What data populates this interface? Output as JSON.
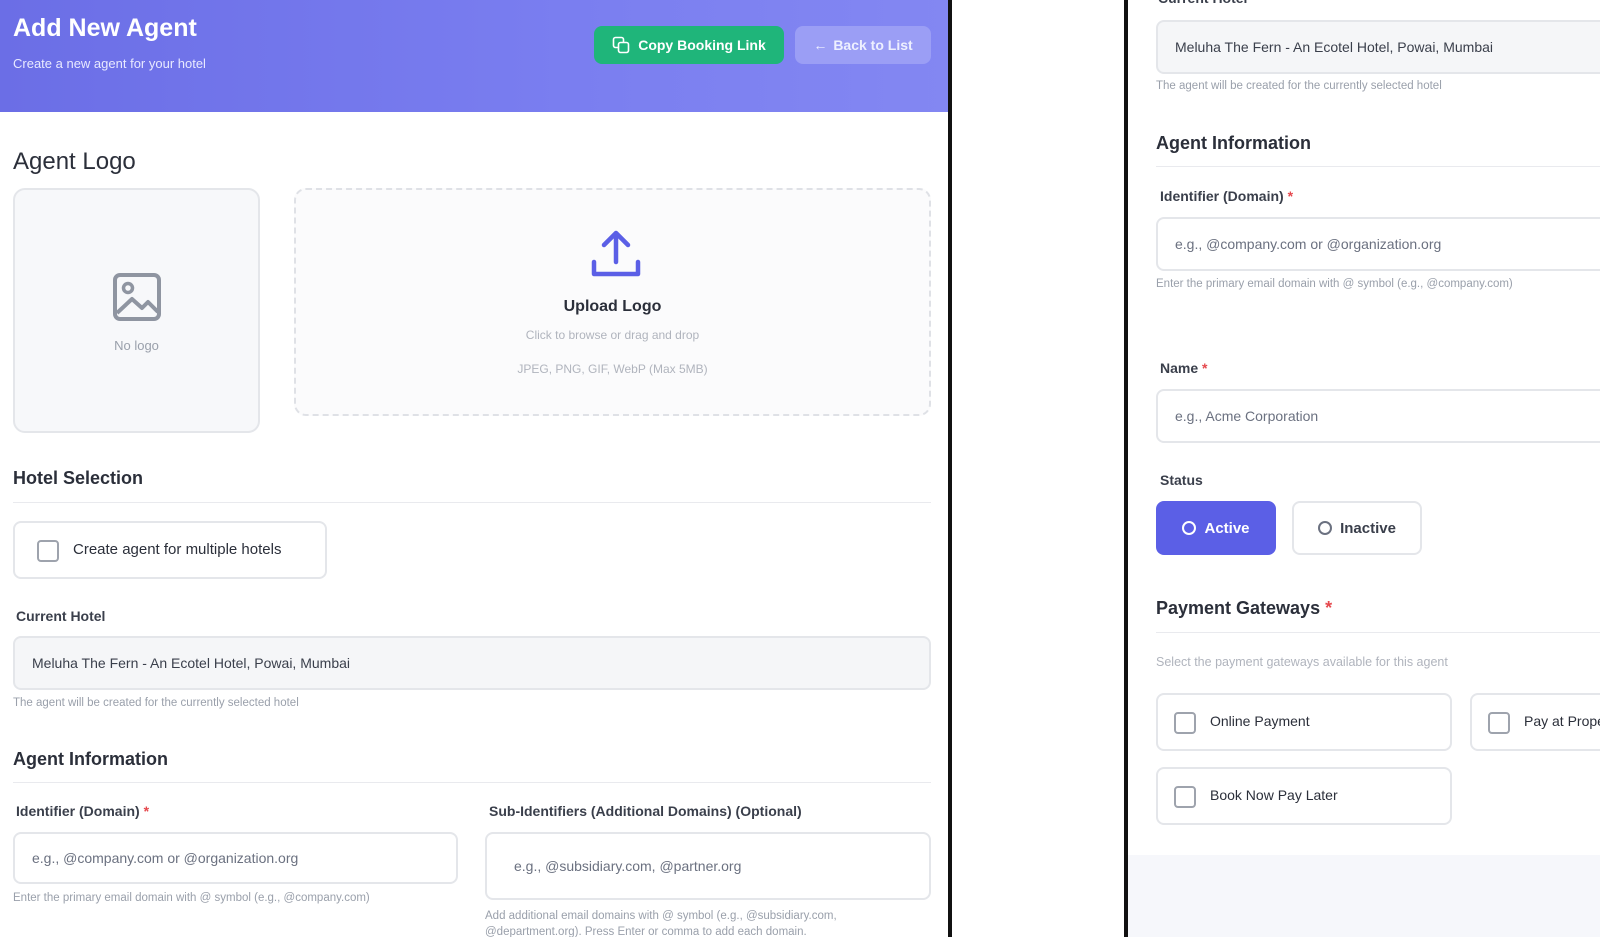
{
  "header": {
    "title": "Add New Agent",
    "subtitle": "Create a new agent for your hotel",
    "copy_button": "Copy Booking Link",
    "back_button": "Back to List"
  },
  "logo": {
    "heading": "Agent Logo",
    "no_logo": "No logo",
    "upload_title": "Upload Logo",
    "upload_hint": "Click to browse or drag and drop",
    "upload_formats": "JPEG, PNG, GIF, WebP (Max 5MB)"
  },
  "hotel_selection": {
    "heading": "Hotel Selection",
    "multi_checkbox": "Create agent for multiple hotels",
    "current_label": "Current Hotel",
    "current_value": "Meluha The Fern - An Ecotel Hotel, Powai, Mumbai",
    "current_help": "The agent will be created for the currently selected hotel"
  },
  "agent_info": {
    "heading": "Agent Information",
    "identifier_label": "Identifier (Domain)",
    "identifier_placeholder": "e.g., @company.com or @organization.org",
    "identifier_help": "Enter the primary email domain with @ symbol (e.g., @company.com)",
    "sub_label": "Sub-Identifiers (Additional Domains) (Optional)",
    "sub_placeholder": "e.g., @subsidiary.com, @partner.org",
    "sub_help": "Add additional email domains with @ symbol (e.g., @subsidiary.com, @department.org). Press Enter or comma to add each domain.",
    "name_label": "Name",
    "name_placeholder": "e.g., Acme Corporation",
    "status_label": "Status",
    "status_active": "Active",
    "status_inactive": "Inactive"
  },
  "payment": {
    "heading": "Payment Gateways",
    "help": "Select the payment gateways available for this agent",
    "options": [
      "Online Payment",
      "Pay at Property",
      "Book Now Pay Later"
    ]
  },
  "colors": {
    "header_gradient_start": "#6b6ee6",
    "header_gradient_end": "#8387f2",
    "copy_button_bg": "#1fb57a",
    "back_button_bg": "#9b9ef5",
    "active_status_bg": "#5b5fe6",
    "upload_icon": "#5b5fe6"
  }
}
